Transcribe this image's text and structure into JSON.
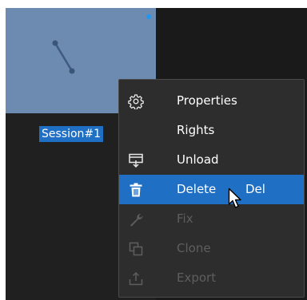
{
  "workspace": {
    "session_label": "Session#1"
  },
  "context_menu": {
    "items": [
      {
        "label": "Properties",
        "icon": "gear-icon",
        "enabled": true
      },
      {
        "label": "Rights",
        "icon": "",
        "enabled": true
      },
      {
        "label": "Unload",
        "icon": "unload-icon",
        "enabled": true
      },
      {
        "label": "Delete",
        "icon": "trash-icon",
        "enabled": true,
        "highlighted": true,
        "shortcut": "Del"
      },
      {
        "label": "Fix",
        "icon": "wrench-icon",
        "enabled": false
      },
      {
        "label": "Clone",
        "icon": "clone-icon",
        "enabled": false
      },
      {
        "label": "Export",
        "icon": "export-icon",
        "enabled": false
      }
    ]
  },
  "colors": {
    "thumbnail": "#6d8bb1",
    "selection": "#1f6fc5",
    "menu_bg": "#2d2d2d",
    "disabled_text": "#5e5e5e"
  }
}
